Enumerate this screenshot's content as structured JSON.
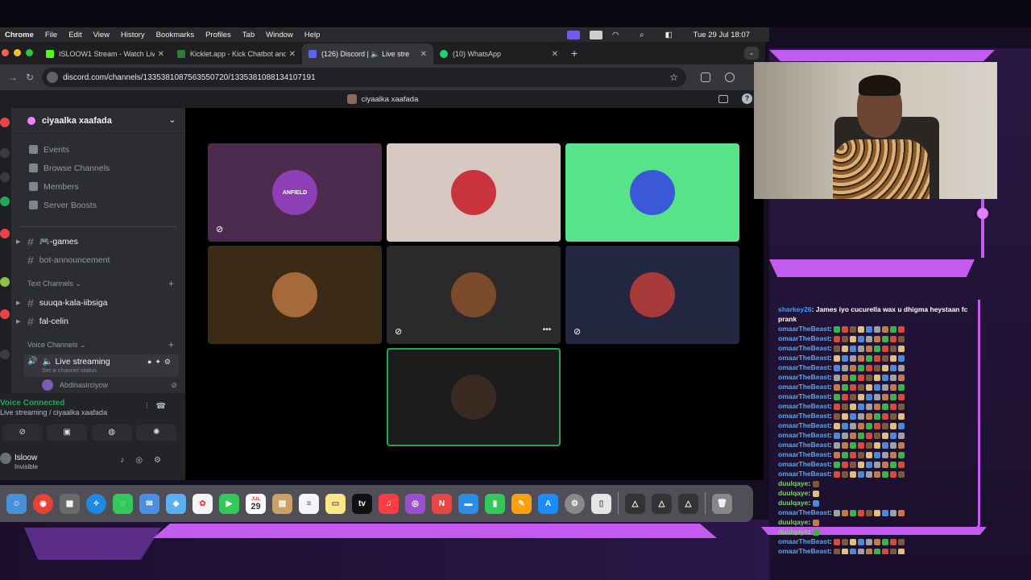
{
  "menubar": {
    "app": "Chrome",
    "items": [
      "File",
      "Edit",
      "View",
      "History",
      "Bookmarks",
      "Profiles",
      "Tab",
      "Window",
      "Help"
    ],
    "datetime": "Tue 29 Jul  18:07"
  },
  "tabs": [
    {
      "title": "ISLOOW1 Stream - Watch Live",
      "color": "#53fc18"
    },
    {
      "title": "Kicklet.app - Kick Chatbot and",
      "color": "#53fc18"
    },
    {
      "title": "(126) Discord | 🔈 Live stre",
      "color": "#5865f2"
    },
    {
      "title": "(10) WhatsApp",
      "color": "#25d366"
    }
  ],
  "address": {
    "url": "discord.com/channels/1335381087563550720/1335381088134107191"
  },
  "discord": {
    "window_title": "ciyaalka xaafada",
    "server_name": "ciyaalka xaafada",
    "nav": [
      "Events",
      "Browse Channels",
      "Members",
      "Server Boosts"
    ],
    "channels_top": [
      "🎮-games",
      "bot-announcement"
    ],
    "text_category": "Text Channels",
    "text_channels": [
      "suuqa-kala-iibsiga",
      "fal-celin"
    ],
    "voice_category": "Voice Channels",
    "voice_channel": {
      "name": "🔈 Live streaming",
      "status": "Set a channel status"
    },
    "voice_user": "Abdinasirciyow",
    "voice_panel": {
      "status": "Voice Connected",
      "sub": "Live streaming / ciyaalka xaafada"
    },
    "user": {
      "name": "Isloow",
      "status": "Invisible"
    },
    "tiles": [
      {
        "bg": "#4b2c4f",
        "avatar": "ANFIELD",
        "avcolor": "#8e3fb5"
      },
      {
        "bg": "#d8c8c2",
        "avatar": "",
        "avcolor": "#c9343c"
      },
      {
        "bg": "#57e389",
        "avatar": "",
        "avcolor": "#3a58d8"
      },
      {
        "bg": "#3b2a16",
        "avatar": "",
        "avcolor": "#a66a3a"
      },
      {
        "bg": "#2a2a2a",
        "avatar": "",
        "avcolor": "#7a4a2a"
      },
      {
        "bg": "#222640",
        "avatar": "",
        "avcolor": "#a83a3a"
      },
      {
        "bg": "#1c1c1c",
        "avatar": "",
        "avcolor": "#3a2a22"
      }
    ]
  },
  "dock": {
    "calendar_month": "JUL",
    "calendar_day": "29",
    "tv_label": "tv"
  },
  "chat": [
    {
      "user": "sharkey26",
      "msg": ": James iyo cucurella wax u dhigma heystaan fc prank",
      "cls": "u3"
    },
    {
      "user": "omaarTheBeast",
      "msg": ":",
      "cls": "u"
    },
    {
      "user": "omaarTheBeast",
      "msg": ":",
      "cls": "u"
    },
    {
      "user": "omaarTheBeast",
      "msg": ":",
      "cls": "u"
    },
    {
      "user": "omaarTheBeast",
      "msg": ":",
      "cls": "u"
    },
    {
      "user": "omaarTheBeast",
      "msg": ":",
      "cls": "u"
    },
    {
      "user": "omaarTheBeast",
      "msg": ":",
      "cls": "u"
    },
    {
      "user": "omaarTheBeast",
      "msg": ":",
      "cls": "u"
    },
    {
      "user": "omaarTheBeast",
      "msg": ":",
      "cls": "u"
    },
    {
      "user": "omaarTheBeast",
      "msg": ":",
      "cls": "u"
    },
    {
      "user": "omaarTheBeast",
      "msg": ":",
      "cls": "u"
    },
    {
      "user": "omaarTheBeast",
      "msg": ":",
      "cls": "u"
    },
    {
      "user": "omaarTheBeast",
      "msg": ":",
      "cls": "u"
    },
    {
      "user": "omaarTheBeast",
      "msg": ":",
      "cls": "u"
    },
    {
      "user": "omaarTheBeast",
      "msg": ":",
      "cls": "u"
    },
    {
      "user": "omaarTheBeast",
      "msg": ":",
      "cls": "u"
    },
    {
      "user": "omaarTheBeast",
      "msg": ":",
      "cls": "u"
    },
    {
      "user": "duulqaye",
      "msg": ":",
      "cls": "u2"
    },
    {
      "user": "duulqaye",
      "msg": ":",
      "cls": "u2"
    },
    {
      "user": "duulqaye",
      "msg": ":",
      "cls": "u2"
    },
    {
      "user": "omaarTheBeast",
      "msg": ":",
      "cls": "u"
    },
    {
      "user": "duulqaye",
      "msg": ":",
      "cls": "u2"
    },
    {
      "user": "duulqaye",
      "msg": ":",
      "cls": "u2"
    },
    {
      "user": "omaarTheBeast",
      "msg": ":",
      "cls": "u"
    },
    {
      "user": "omaarTheBeast",
      "msg": ":",
      "cls": "u"
    }
  ]
}
